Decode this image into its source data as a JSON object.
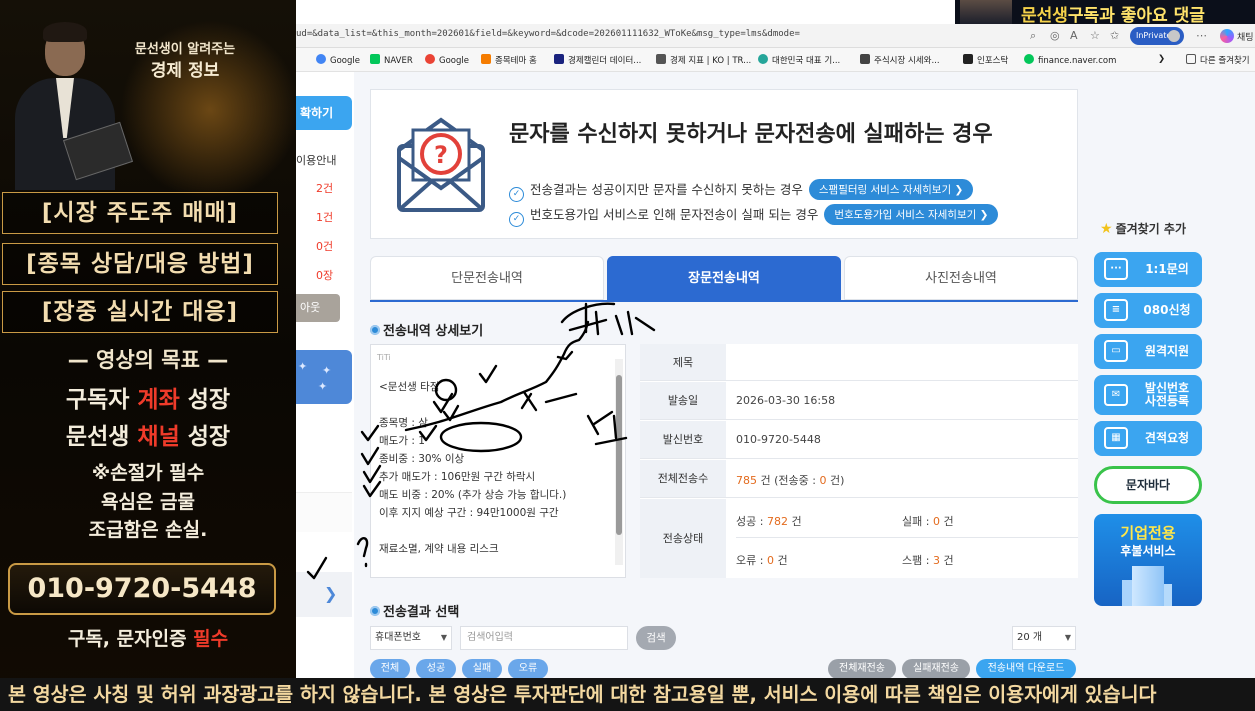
{
  "promo": {
    "small_title": "문선생이 알려주는",
    "big_title": "경제 정보",
    "box1": "[시장 주도주 매매]",
    "box2": "[종목 상담/대응 방법]",
    "box3": "[장중 실시간 대응]",
    "goal_title": "영상의 목표",
    "goal_line1_a": "구독자 ",
    "goal_line1_b": "계좌",
    "goal_line1_c": " 성장",
    "goal_line2_a": "문선생 ",
    "goal_line2_b": "채널",
    "goal_line2_c": " 성장",
    "note1": "※손절가 필수",
    "note2": "욕심은 금물",
    "note3": "조급함은 손실.",
    "phone": "010-9720-5448",
    "sub_a": "구독, 문자인증 ",
    "sub_b": "필수"
  },
  "channel_banner": {
    "name": "문선생",
    "rest": "구독과 좋아요 댓글"
  },
  "browser": {
    "address": "ud=&data_list=&this_month=202601&field=&keyword=&dcode=202601111632_WToKe&msg_type=lms&dmode=",
    "inprivate": "InPrivate",
    "copilot": "채팅",
    "bookmarks": [
      {
        "label": "Google",
        "color": "#4285f4"
      },
      {
        "label": "NAVER",
        "color": "#03c75a"
      },
      {
        "label": "Google",
        "color": "#ea4335"
      },
      {
        "label": "종목테마 홈",
        "color": "#f57c00"
      },
      {
        "label": "경제캘린더 데이터...",
        "color": "#1a237e"
      },
      {
        "label": "경제 지표 | KO | TR...",
        "color": "#555555"
      },
      {
        "label": "대한민국 대표 기...",
        "color": "#26a69a"
      },
      {
        "label": "주식시장 시세와...",
        "color": "#444444"
      },
      {
        "label": "인포스탁",
        "color": "#222222"
      },
      {
        "label": "finance.naver.com",
        "color": "#03c75a"
      }
    ],
    "other_favorites": "다른 즐겨찾기"
  },
  "sidebar": {
    "top_button": "확하기",
    "usage": "이용안내",
    "counts": [
      "2건",
      "1건",
      "0건",
      "0장"
    ],
    "logout": "아웃"
  },
  "info": {
    "title": "문자를 수신하지 못하거나 문자전송에 실패하는 경우",
    "row1": "전송결과는 성공이지만 문자를 수신하지 못하는 경우",
    "row1_btn": "스팸필터링 서비스 자세히보기 ❯",
    "row2": "번호도용가입 서비스로 인해 문자전송이 실패 되는 경우",
    "row2_btn": "번호도용가입 서비스 자세히보기 ❯"
  },
  "tabs": [
    "단문전송내역",
    "장문전송내역",
    "사진전송내역"
  ],
  "detail_section": "전송내역 상세보기",
  "message": {
    "head": "TiTi",
    "lines": [
      "<문선생 타점",
      "",
      "종목명 : 삼",
      "매도가 : 1",
      "종비중 : 30% 이상",
      "추가 매도가 : 106만원 구간 하락시",
      "매도 비중 : 20% (추가 상승 가능 합니다.)",
      "이후 지지 예상 구간 : 94만1000원 구간",
      "",
      "재료소멸, 계약 내용 리스크"
    ]
  },
  "detail": {
    "subject_label": "제목",
    "date_label": "발송일",
    "date": "2026-03-30 16:58",
    "sender_label": "발신번호",
    "sender": "010-9720-5448",
    "total_label": "전체전송수",
    "total_num": "785",
    "total_rest": " 건 (전송중 : ",
    "sending": "0",
    "total_end": " 건)",
    "status_label": "전송상태",
    "success_label": "성공 : ",
    "success": "782",
    "fail_label": "실패 : ",
    "fail": "0",
    "error_label": "오류 : ",
    "error": "0",
    "spam_label": "스팸 : ",
    "spam": "3",
    "unit": " 건"
  },
  "result_section": "전송결과 선택",
  "search": {
    "phone_select": "휴대폰번호",
    "placeholder": "검색어입력",
    "button": "검색",
    "page_size": "20 개"
  },
  "filters": [
    "전체",
    "성공",
    "실패",
    "오류"
  ],
  "actions": [
    "전체재전송",
    "실패재전송",
    "전송내역 다운로드"
  ],
  "quick": {
    "fav_add": "즐겨찾기 추가",
    "items": [
      "1:1문의",
      "080신청",
      "원격지원",
      "발신번호\n사전등록",
      "견적요청"
    ],
    "bada": "문자바다",
    "ent1": "기업전용",
    "ent2": "후불서비스"
  },
  "annotations": {
    "a1": "캐비번",
    "a2": "캐치"
  },
  "disclaimer": "본 영상은 사칭 및 허위 과장광고를 하지 않습니다. 본 영상은 투자판단에 대한 참고용일 뿐, 서비스 이용에 따른 책임은 이용자에게 있습니다"
}
